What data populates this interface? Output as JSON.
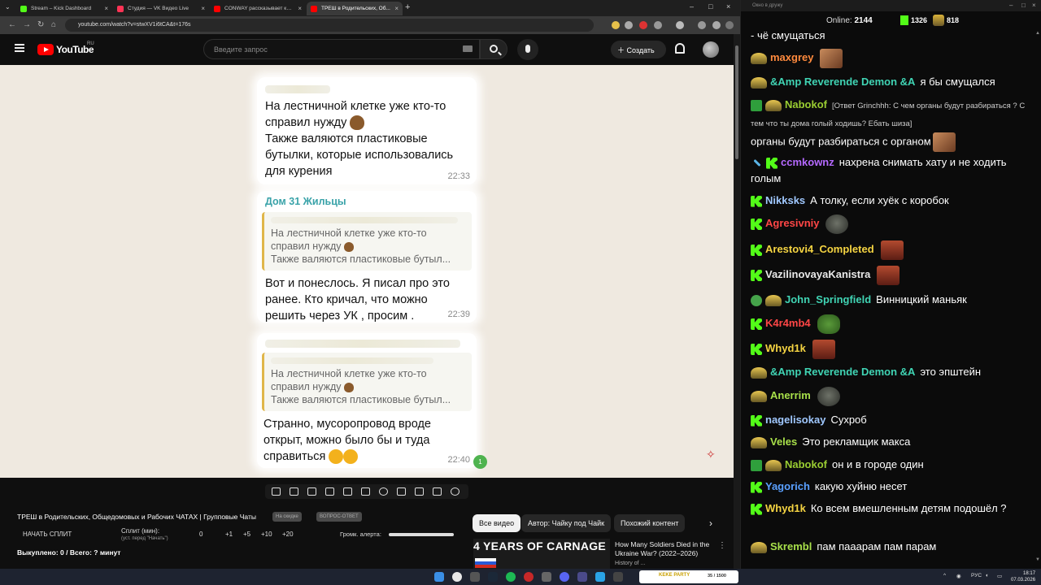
{
  "browser": {
    "tabs": [
      {
        "label": "Stream – Kick Dashboard",
        "color": "#53fc18"
      },
      {
        "label": "Студия — VK Видео Live",
        "color": "#ff3355"
      },
      {
        "label": "CONWAY рассказывает как п...",
        "color": "#ff0000"
      },
      {
        "label": "ТРЕШ в Родительских, Об...",
        "color": "#ff0000",
        "active": true
      }
    ],
    "url": "youtube.com/watch?v=stwXV1i6tCA&t=176s"
  },
  "youtube": {
    "logo": "YouTube",
    "region": "RU",
    "search_placeholder": "Введите запрос",
    "create_label": "Создать"
  },
  "video": {
    "messages": [
      {
        "text_lines": [
          "На лестничной клетке уже кто-то",
          "справил нужду",
          "Также валяются пластиковые",
          "бутылки, которые использовались",
          "для курения"
        ],
        "time": "22:33"
      },
      {
        "sender": "Дом 31 Жильцы",
        "quote_lines": [
          "На лестничной клетке уже кто-то",
          "справил нужду",
          "Также валяются пластиковые бутыл..."
        ],
        "text_lines": [
          "Вот и понеслось. Я писал про это",
          "ранее. Кто кричал, что можно",
          "решить через УК , просим ."
        ],
        "time": "22:39"
      },
      {
        "quote_lines": [
          "На лестничной клетке уже кто-то",
          "справил нужду",
          "Также валяются пластиковые бутыл..."
        ],
        "text_lines": [
          "Странно, мусоропровод вроде",
          "открыт, можно было бы и туда",
          "справиться"
        ],
        "time": "22:40",
        "unread": "1"
      }
    ],
    "title": "ТРЕШ в Родительских, Общедомовых и Рабочих ЧАТАХ | Групповые Чаты",
    "chip_a": "На скидке",
    "chip_b": "ВОПРОС-ОТВЕТ",
    "split": {
      "start_label": "НАЧАТЬ СПЛИТ",
      "split_label": "Сплит (мин):",
      "split_sub": "(уст. перед \"Начать\")",
      "value": "0",
      "steps": [
        "+1",
        "+5",
        "+10",
        "+20"
      ],
      "alert_label": "Громк. алерта:"
    },
    "bought": "Выкуплено: 0 / Всего: ? минут"
  },
  "filters": [
    "Все видео",
    "Автор: Чайку под Чайк",
    "Похожий контент"
  ],
  "recommendation": {
    "thumb_text": "4 YEARS OF CARNAGE",
    "title": "How Many Soldiers Died in the Ukraine War? (2022–2026)",
    "channel": "History of ..."
  },
  "chat": {
    "window_title": "Окно в дружу",
    "online_label": "Online:",
    "online_count": "2144",
    "kick_count": "1326",
    "sub_count": "818",
    "messages": [
      {
        "badges": [],
        "user": "",
        "color": "#fff",
        "text": "- чё смущаться",
        "emote": ""
      },
      {
        "badges": [
          "sub"
        ],
        "user": "maxgrey",
        "color": "#ff8a3d",
        "text": "",
        "emote": "face"
      },
      {
        "badges": [
          "sub"
        ],
        "user": "&Amp Reverende Demon &A",
        "color": "#40d4b4",
        "text": "я бы смущался",
        "emote": ""
      },
      {
        "badges": [
          "check",
          "sub"
        ],
        "user": "Nabokof",
        "color": "#9acd32",
        "reply": "[Ответ Grinchhh: С чем органы будут разбираться ? С тем что ты дома голый ходишь? Ебать шиза]",
        "text": "органы будут разбираться с органом",
        "emote": "face"
      },
      {
        "badges": [
          "sword",
          "k"
        ],
        "user": "ccmkownz",
        "color": "#b569ff",
        "text": "нахрена снимать хату и не ходить голым",
        "emote": ""
      },
      {
        "badges": [
          "k"
        ],
        "user": "Nikksks",
        "color": "#a0c8ff",
        "text": "А толку, если хуёк с коробок",
        "emote": ""
      },
      {
        "badges": [
          "k"
        ],
        "user": "Agresivniy",
        "color": "#ff4646",
        "text": "",
        "emote": "seal"
      },
      {
        "badges": [
          "k"
        ],
        "user": "Arestovi4_Completed",
        "color": "#f5d442",
        "text": "",
        "emote": "laugh"
      },
      {
        "badges": [
          "k"
        ],
        "user": "VazilinovayaKanistra",
        "color": "#e8e8e8",
        "text": "",
        "emote": "laugh"
      },
      {
        "badges": [
          "mod",
          "sub"
        ],
        "user": "John_Springfield",
        "color": "#40d4b4",
        "text": "Винницкий маньяк",
        "emote": ""
      },
      {
        "badges": [
          "k"
        ],
        "user": "K4r4mb4",
        "color": "#ff4646",
        "text": "",
        "emote": "frog"
      },
      {
        "badges": [
          "k"
        ],
        "user": "Whyd1k",
        "color": "#f5d442",
        "text": "",
        "emote": "laugh"
      },
      {
        "badges": [
          "sub"
        ],
        "user": "&Amp Reverende Demon &A",
        "color": "#40d4b4",
        "text": "это эпштейн",
        "emote": ""
      },
      {
        "badges": [
          "sub"
        ],
        "user": "Anerrim",
        "color": "#a8e04a",
        "text": "",
        "emote": "seal"
      },
      {
        "badges": [
          "k"
        ],
        "user": "nagelisokay",
        "color": "#a0c8ff",
        "text": "Сухроб",
        "emote": ""
      },
      {
        "badges": [
          "sub"
        ],
        "user": "Veles",
        "color": "#a8e04a",
        "text": "Это рекламщик макса",
        "emote": ""
      },
      {
        "badges": [
          "check",
          "sub"
        ],
        "user": "Nabokof",
        "color": "#9acd32",
        "text": "он и в городе один",
        "emote": ""
      },
      {
        "badges": [
          "k"
        ],
        "user": "Yagorich",
        "color": "#5aa0ff",
        "text": "какую хуйню несет",
        "emote": ""
      },
      {
        "badges": [
          "k"
        ],
        "user": "Whyd1k",
        "color": "#f5d442",
        "text": "Ко всем вмешленным детям подошёл ?",
        "emote": ""
      },
      {
        "badges": [
          "sub"
        ],
        "user": "Skrembl",
        "color": "#a8e04a",
        "text": "пам пааарам пам парам",
        "emote": ""
      }
    ]
  },
  "taskbar": {
    "media_label": "KEKE PARTY",
    "media_count": "35 / 1500",
    "lang": "РУС",
    "time": "18:17",
    "date": "07.03.2026"
  }
}
